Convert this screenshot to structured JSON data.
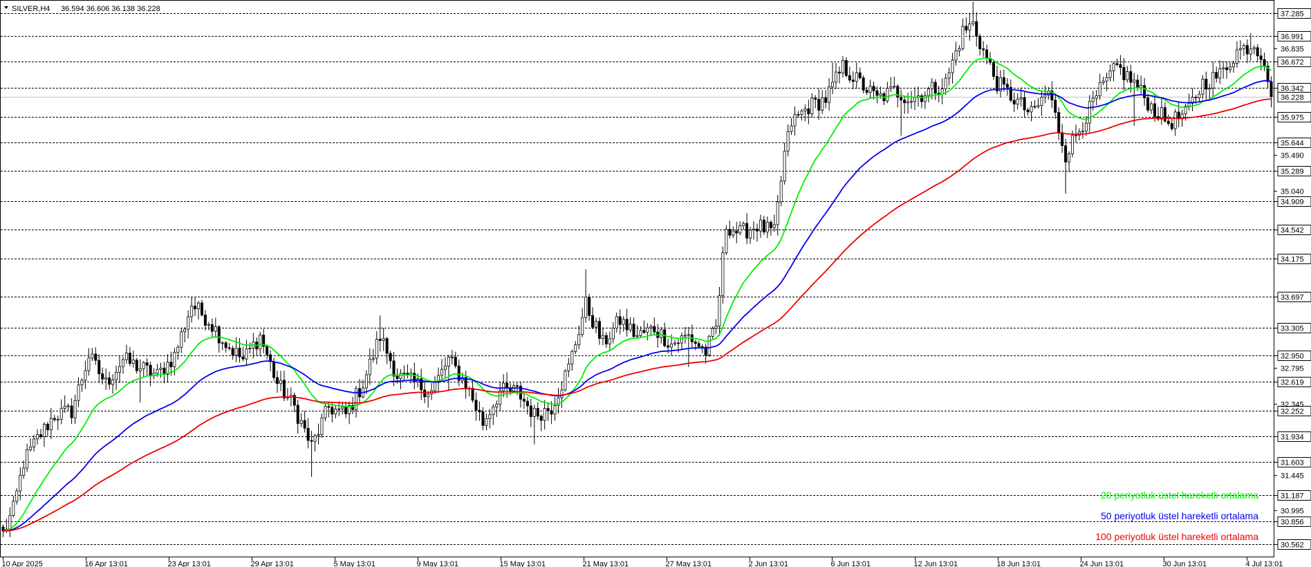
{
  "chart_data": {
    "type": "candlestick",
    "header": {
      "symbol": "SILVER,H4",
      "ohlc": "36.594 36.606 36.138 36.228"
    },
    "y_range": [
      30.4,
      37.45
    ],
    "current_price": "36.228",
    "level_labels": [
      "37.285",
      "36.991",
      "36.672",
      "36.342",
      "35.975",
      "35.644",
      "35.289",
      "34.909",
      "34.542",
      "34.175",
      "33.697",
      "33.305",
      "32.950",
      "32.619",
      "32.252",
      "31.934",
      "31.603",
      "31.187",
      "30.856",
      "30.562"
    ],
    "scale_labels": [
      "36.835",
      "35.490",
      "35.040",
      "32.795",
      "32.345",
      "31.445",
      "30.995"
    ],
    "x_labels": [
      "10 Apr 2025",
      "16 Apr 13:01",
      "23 Apr 13:01",
      "29 Apr 13:01",
      "5 May 13:01",
      "9 May 13:01",
      "15 May 13:01",
      "21 May 13:01",
      "27 May 13:01",
      "2 Jun 13:01",
      "6 Jun 13:01",
      "12 Jun 13:01",
      "18 Jun 13:01",
      "24 Jun 13:01",
      "30 Jun 13:01",
      "4 Jul 13:01"
    ],
    "close_anchors": [
      [
        0,
        30.7
      ],
      [
        3,
        31.0
      ],
      [
        6,
        31.6
      ],
      [
        10,
        31.9
      ],
      [
        15,
        32.2
      ],
      [
        20,
        32.25
      ],
      [
        25,
        32.95
      ],
      [
        30,
        32.6
      ],
      [
        35,
        32.9
      ],
      [
        40,
        32.8
      ],
      [
        45,
        32.7
      ],
      [
        50,
        32.95
      ],
      [
        55,
        33.6
      ],
      [
        60,
        33.4
      ],
      [
        65,
        33.1
      ],
      [
        70,
        32.9
      ],
      [
        75,
        33.2
      ],
      [
        80,
        32.6
      ],
      [
        85,
        32.3
      ],
      [
        90,
        31.8
      ],
      [
        95,
        32.3
      ],
      [
        100,
        32.2
      ],
      [
        105,
        32.6
      ],
      [
        110,
        33.2
      ],
      [
        115,
        32.7
      ],
      [
        120,
        32.6
      ],
      [
        125,
        32.5
      ],
      [
        130,
        32.9
      ],
      [
        135,
        32.6
      ],
      [
        140,
        32.1
      ],
      [
        145,
        32.5
      ],
      [
        150,
        32.5
      ],
      [
        155,
        32.2
      ],
      [
        160,
        32.3
      ],
      [
        165,
        32.8
      ],
      [
        170,
        33.6
      ],
      [
        175,
        33.1
      ],
      [
        180,
        33.4
      ],
      [
        185,
        33.2
      ],
      [
        190,
        33.3
      ],
      [
        195,
        33.1
      ],
      [
        200,
        33.2
      ],
      [
        205,
        33.0
      ],
      [
        208,
        33.3
      ],
      [
        211,
        34.6
      ],
      [
        215,
        34.5
      ],
      [
        220,
        34.6
      ],
      [
        225,
        34.5
      ],
      [
        228,
        35.5
      ],
      [
        230,
        35.9
      ],
      [
        235,
        36.1
      ],
      [
        240,
        36.2
      ],
      [
        245,
        36.6
      ],
      [
        250,
        36.4
      ],
      [
        255,
        36.2
      ],
      [
        260,
        36.3
      ],
      [
        265,
        36.2
      ],
      [
        270,
        36.3
      ],
      [
        275,
        36.4
      ],
      [
        280,
        37.05
      ],
      [
        283,
        37.15
      ],
      [
        286,
        36.8
      ],
      [
        290,
        36.4
      ],
      [
        295,
        36.2
      ],
      [
        300,
        36.0
      ],
      [
        305,
        36.3
      ],
      [
        310,
        35.5
      ],
      [
        315,
        35.9
      ],
      [
        320,
        36.3
      ],
      [
        325,
        36.6
      ],
      [
        330,
        36.4
      ],
      [
        335,
        36.1
      ],
      [
        340,
        35.9
      ],
      [
        345,
        36.0
      ],
      [
        350,
        36.4
      ],
      [
        355,
        36.5
      ],
      [
        360,
        36.8
      ],
      [
        365,
        36.9
      ],
      [
        368,
        36.7
      ],
      [
        370,
        36.228
      ]
    ],
    "wick_spikes": [
      [
        40,
        -0.4
      ],
      [
        90,
        -0.45
      ],
      [
        110,
        0.3
      ],
      [
        130,
        -0.3
      ],
      [
        155,
        -0.35
      ],
      [
        170,
        0.35
      ],
      [
        200,
        -0.4
      ],
      [
        242,
        0.25
      ],
      [
        262,
        -0.45
      ],
      [
        283,
        0.25
      ],
      [
        310,
        -0.4
      ],
      [
        330,
        -0.55
      ],
      [
        364,
        0.2
      ],
      [
        370,
        0.0
      ]
    ],
    "series": [
      {
        "name": "20 periyotluk üstel hareketli ortalama",
        "period": 20,
        "color": "#00ee00"
      },
      {
        "name": "50 periyotluk üstel hareketli ortalama",
        "period": 50,
        "color": "#0000ee"
      },
      {
        "name": "100 periyotluk üstel hareketli ortalama",
        "period": 100,
        "color": "#ee0000"
      }
    ],
    "candle_count": 371,
    "grid": "dashed horizontal at level labels",
    "legend_placement": "bottom-right"
  }
}
